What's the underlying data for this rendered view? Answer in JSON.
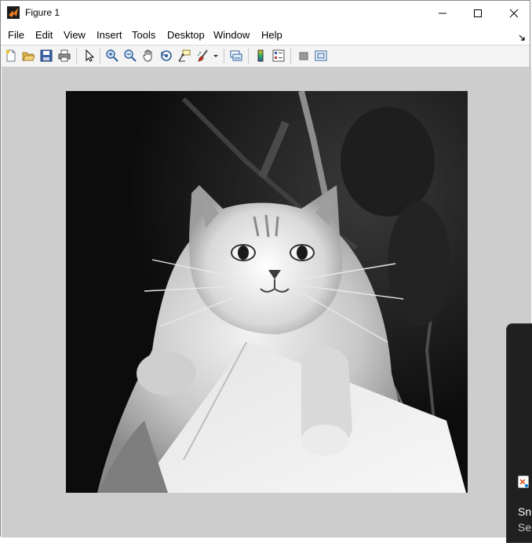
{
  "window": {
    "title": "Figure 1",
    "accent": "#d35400"
  },
  "menu": {
    "items": [
      "File",
      "Edit",
      "View",
      "Insert",
      "Tools",
      "Desktop",
      "Window",
      "Help"
    ]
  },
  "toolbar": {
    "buttons": [
      "new-figure-icon",
      "open-file-icon",
      "save-icon",
      "print-icon",
      "edit-plot-arrow-icon",
      "zoom-in-icon",
      "zoom-out-icon",
      "pan-hand-icon",
      "rotate-3d-icon",
      "data-cursor-icon",
      "brush-icon",
      "brush-dropdown-icon",
      "link-plot-icon",
      "insert-colorbar-icon",
      "insert-legend-icon",
      "hide-plot-tools-icon",
      "show-plot-tools-icon"
    ]
  },
  "figure": {
    "background": "#cdcdcd",
    "image_description_icon": "grayscale-cat-image"
  },
  "notification": {
    "title": "Sni",
    "subtitle": "Sel"
  }
}
